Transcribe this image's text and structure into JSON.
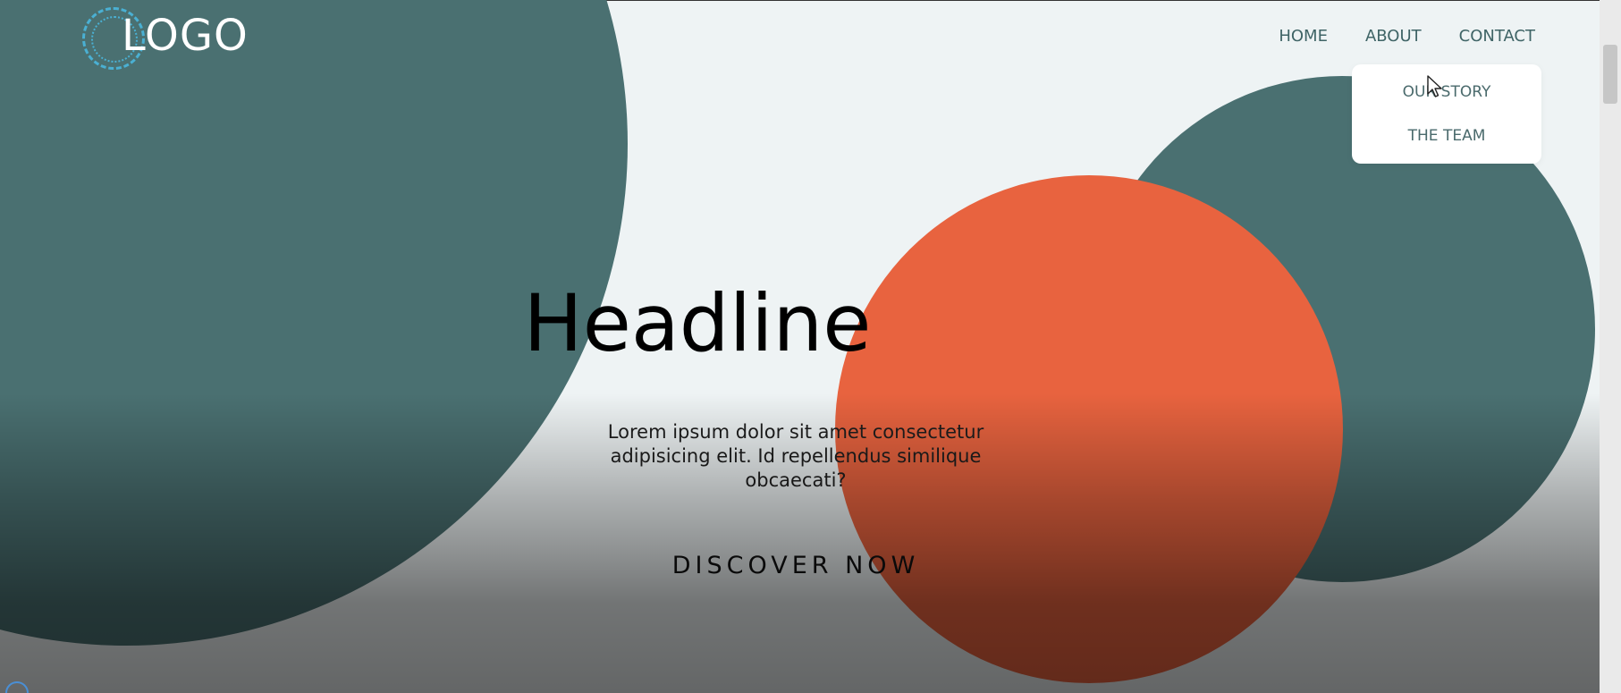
{
  "logo": {
    "text": "LOGO",
    "ring_icon": "dashed-circle-logo-icon"
  },
  "nav": {
    "items": [
      {
        "label": "HOME"
      },
      {
        "label": "ABOUT"
      },
      {
        "label": "CONTACT"
      }
    ]
  },
  "dropdown": {
    "items": [
      {
        "label": "OUR STORY"
      },
      {
        "label": "THE TEAM"
      }
    ]
  },
  "hero": {
    "headline": "Headline",
    "subtext": "Lorem ipsum dolor sit amet consectetur adipisicing elit. Id repellendus similique obcaecati?",
    "cta": "DISCOVER NOW"
  },
  "colors": {
    "teal": "#4a7071",
    "orange": "#e8633f",
    "background": "#eef3f4",
    "logo_accent": "#4ab0d3"
  }
}
